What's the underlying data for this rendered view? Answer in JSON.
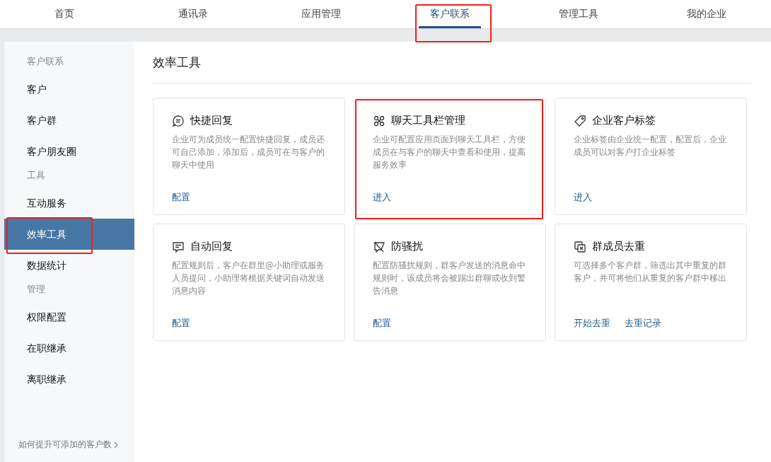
{
  "top_nav": {
    "tabs": [
      {
        "label": "首页",
        "selected": false,
        "highlighted": false
      },
      {
        "label": "通讯录",
        "selected": false,
        "highlighted": false
      },
      {
        "label": "应用管理",
        "selected": false,
        "highlighted": false
      },
      {
        "label": "客户联系",
        "selected": true,
        "highlighted": true
      },
      {
        "label": "管理工具",
        "selected": false,
        "highlighted": false
      },
      {
        "label": "我的企业",
        "selected": false,
        "highlighted": false
      }
    ]
  },
  "sidebar": {
    "sections": [
      {
        "title": "客户联系",
        "items": [
          {
            "label": "客户",
            "selected": false,
            "highlighted": false
          },
          {
            "label": "客户群",
            "selected": false,
            "highlighted": false
          },
          {
            "label": "客户朋友圈",
            "selected": false,
            "highlighted": false
          }
        ]
      },
      {
        "title": "工具",
        "items": [
          {
            "label": "互动服务",
            "selected": false,
            "highlighted": false
          },
          {
            "label": "效率工具",
            "selected": true,
            "highlighted": true
          },
          {
            "label": "数据统计",
            "selected": false,
            "highlighted": false
          }
        ]
      },
      {
        "title": "管理",
        "items": [
          {
            "label": "权限配置",
            "selected": false,
            "highlighted": false
          },
          {
            "label": "在职继承",
            "selected": false,
            "highlighted": false
          },
          {
            "label": "离职继承",
            "selected": false,
            "highlighted": false
          }
        ]
      }
    ],
    "footer_link": "如何提升可添加的客户数"
  },
  "content": {
    "title": "效率工具",
    "cards": [
      {
        "title": "快捷回复",
        "description": "企业可为成员统一配置快捷回复，成员还可自己添加，添加后，成员可在与客户的聊天中使用",
        "actions": [
          "配置"
        ],
        "highlighted": false
      },
      {
        "title": "聊天工具栏管理",
        "description": "企业可配置应用页面到聊天工具栏，方便成员在与客户的聊天中查看和使用，提高服务效率",
        "actions": [
          "进入"
        ],
        "highlighted": true
      },
      {
        "title": "企业客户标签",
        "description": "企业标签由企业统一配置，配置后，企业成员可以对客户打企业标签",
        "actions": [
          "进入"
        ],
        "highlighted": false
      },
      {
        "title": "自动回复",
        "description": "配置规则后，客户在群里@小助理或服务人员提问，小助理将根据关键词自动发送消息内容",
        "actions": [
          "配置"
        ],
        "highlighted": false
      },
      {
        "title": "防骚扰",
        "description": "配置防骚扰规则，群客户发送的消息命中规则时，该成员将会被踢出群聊或收到警告消息",
        "actions": [
          "配置"
        ],
        "highlighted": false
      },
      {
        "title": "群成员去重",
        "description": "可选择多个客户群，筛选出其中重复的群客户，并可将他们从重复的客户群中移出",
        "actions": [
          "开始去重",
          "去重记录"
        ],
        "highlighted": false
      }
    ]
  }
}
